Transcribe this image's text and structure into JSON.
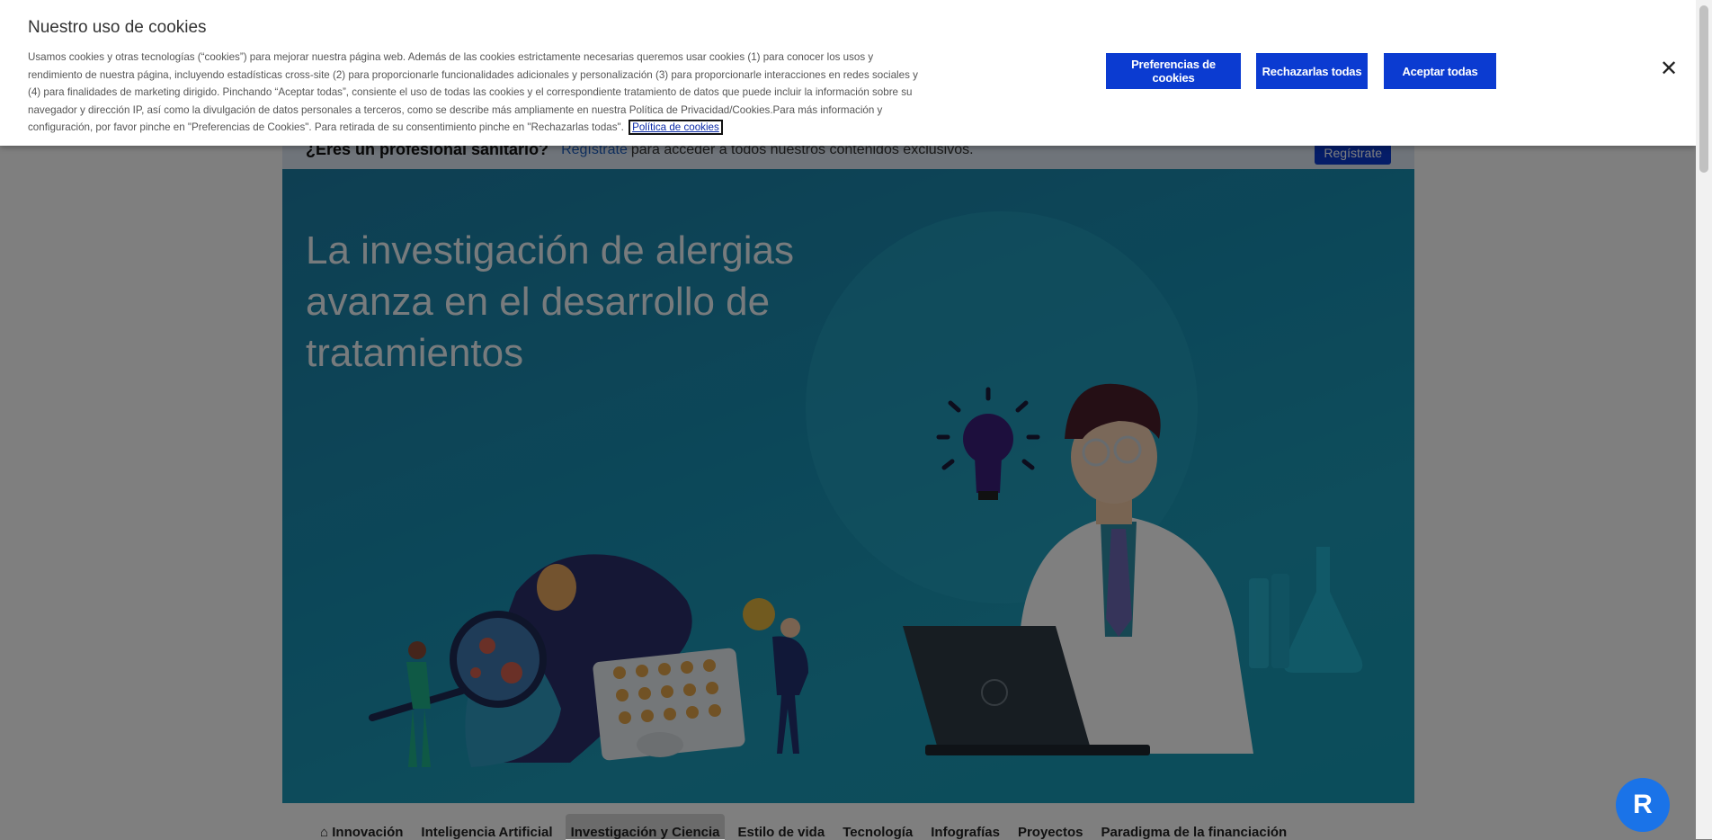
{
  "professional_bar": {
    "question": "¿Eres un profesional sanitario?",
    "register_link": "Regístrate",
    "register_text": "para acceder a todos nuestros contenidos exclusivos.",
    "register_button": "Regístrate"
  },
  "hero": {
    "title": "La investigación de alergias avanza en el desarrollo de tratamientos"
  },
  "nav": {
    "items": [
      {
        "label": "Innovación",
        "icon": "home-icon"
      },
      {
        "label": "Inteligencia Artificial"
      },
      {
        "label": "Investigación y Ciencia",
        "active": true
      },
      {
        "label": "Estilo de vida"
      },
      {
        "label": "Tecnología"
      },
      {
        "label": "Infografías"
      },
      {
        "label": "Proyectos"
      },
      {
        "label": "Paradigma de la financiación"
      }
    ]
  },
  "cookie_banner": {
    "title": "Nuestro uso de cookies",
    "body": "Usamos cookies y otras tecnologías (“cookies”) para mejorar nuestra página web. Además de las cookies estrictamente necesarias queremos usar cookies (1) para conocer los usos y rendimiento de nuestra página, incluyendo estadísticas cross-site (2) para proporcionarle funcionalidades adicionales y personalización (3) para proporcionarle interacciones en redes sociales y (4) para finalidades de marketing dirigido. Pinchando “Aceptar todas”, consiente el uso de todas las cookies y el correspondiente tratamiento de datos que puede incluir la información sobre su navegador y dirección IP, así como la divulgación de datos personales a terceros, como se describe más ampliamente en nuestra Política de Privacidad/Cookies.Para más información y configuración, por favor pinche en \"Preferencias de Cookies\". Para retirada de su consentimiento pinche en \"Rechazarlas todas\".",
    "policy_link": "Política de cookies",
    "buttons": {
      "preferences": "Preferencias de cookies",
      "reject_all": "Rechazarlas todas",
      "accept_all": "Aceptar todas"
    },
    "close_icon": "close-icon"
  },
  "colors": {
    "primary_button": "#0b3bd1",
    "hero_bg": "#1990b3",
    "overlay": "rgba(0,0,0,0.5)"
  }
}
